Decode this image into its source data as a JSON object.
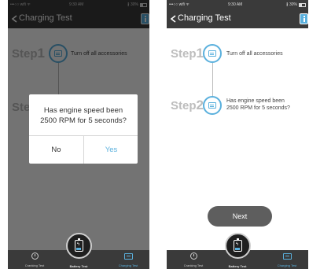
{
  "status_bar": {
    "carrier": "•••○○ wifi  ᯤ",
    "time": "9:30 AM",
    "battery": "∦ 30%"
  },
  "nav": {
    "title": "Charging Test"
  },
  "steps": [
    {
      "label": "Step",
      "number": "1",
      "text": "Turn off all accessories"
    },
    {
      "label": "Step",
      "number": "2",
      "text": "Has engine speed been\n2500 RPM for 5 seconds?"
    }
  ],
  "next_button": {
    "label": "Next"
  },
  "tab_bar": {
    "cranking": "Cranking Test",
    "battery": "Battery Test",
    "charging": "Charging Test"
  },
  "dialog": {
    "message": "Has engine speed been\n2500 RPM for 5 seconds?",
    "no": "No",
    "yes": "Yes"
  },
  "colors": {
    "accent": "#5ab0dd",
    "bar": "#3a3a3a"
  }
}
